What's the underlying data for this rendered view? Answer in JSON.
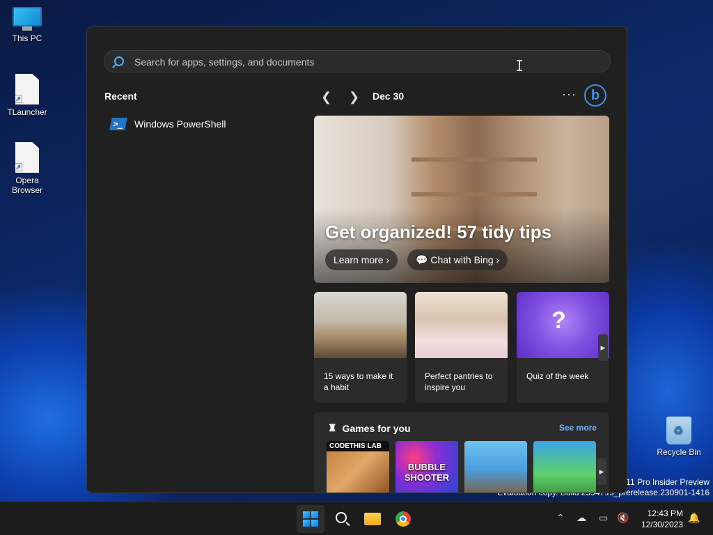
{
  "desktop": {
    "icons": [
      {
        "label": "This PC"
      },
      {
        "label": "TLauncher"
      },
      {
        "label": "Opera\nBrowser"
      },
      {
        "label": "Recycle Bin"
      }
    ],
    "watermark_line1": "s 11 Pro Insider Preview",
    "watermark_line2": "Evaluation copy. Build 25947.rs_prerelease.230901-1416"
  },
  "start": {
    "search": {
      "placeholder": "Search for apps, settings, and documents"
    },
    "recent": {
      "heading": "Recent",
      "items": [
        {
          "label": "Windows PowerShell",
          "icon": "powershell-icon"
        }
      ]
    },
    "widgets": {
      "date": "Dec 30",
      "more": "···",
      "bing": "b",
      "hero": {
        "title": "Get organized! 57 tidy tips",
        "learn_more": "Learn more",
        "chat_bing": "Chat with Bing"
      },
      "cards": [
        {
          "caption": "15 ways to make it a habit"
        },
        {
          "caption": "Perfect pantries to inspire you"
        },
        {
          "caption": "Quiz of the week"
        }
      ],
      "games": {
        "heading": "Games for you",
        "see_more": "See more",
        "tiles": [
          {
            "label": "CODETHIS LAB"
          },
          {
            "label": "BUBBLE SHOOTER"
          },
          {
            "label": ""
          },
          {
            "label": ""
          }
        ]
      }
    }
  },
  "taskbar": {
    "time": "12:43 PM",
    "date": "12/30/2023"
  },
  "colors": {
    "accent": "#4cc2ff",
    "link": "#6cb6ff",
    "panel": "#202020"
  }
}
